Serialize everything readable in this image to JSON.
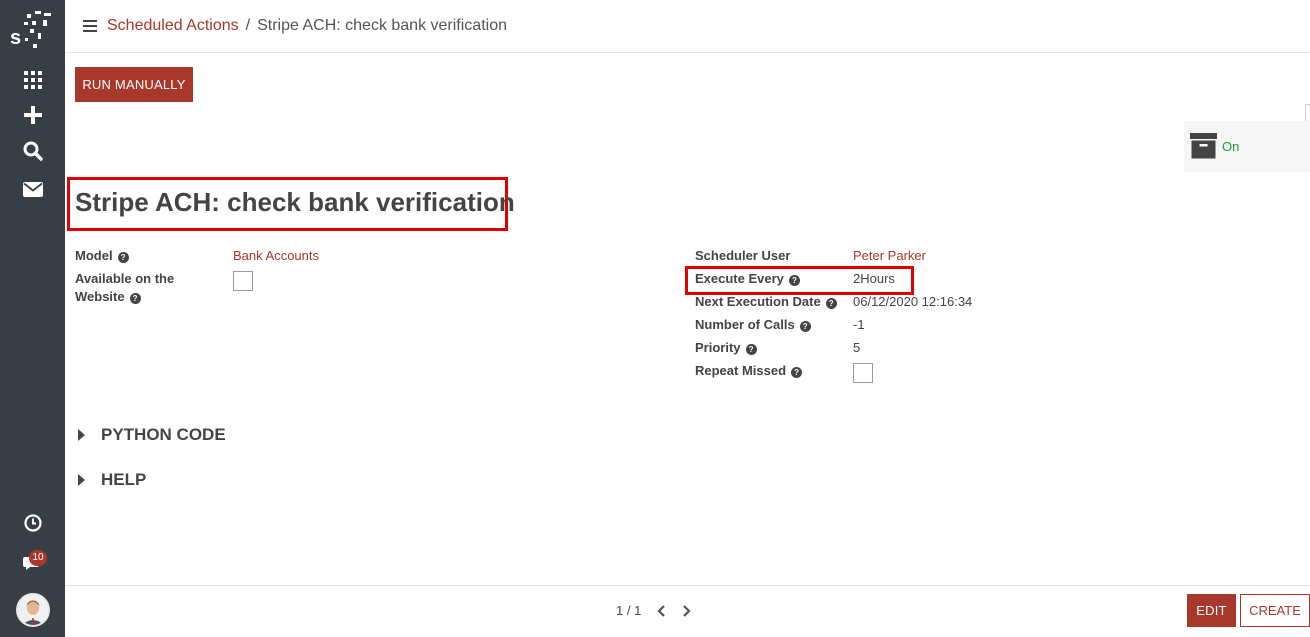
{
  "sidebar": {
    "logo_icon": "odoo-logo-icon",
    "items": [
      {
        "name": "apps-grid-icon"
      },
      {
        "name": "plus-icon"
      },
      {
        "name": "search-icon"
      },
      {
        "name": "envelope-icon"
      }
    ],
    "bottom_items": [
      {
        "name": "clock-icon"
      },
      {
        "name": "chat-icon"
      }
    ],
    "chat_badge": "10"
  },
  "breadcrumb": {
    "parent": "Scheduled Actions",
    "separator": "/",
    "current": "Stripe ACH: check bank verification"
  },
  "toolbar": {
    "run_manually": "RUN MANUALLY"
  },
  "status": {
    "active_label": "On",
    "active_color": "#1b9e37"
  },
  "record": {
    "title": "Stripe ACH: check bank verification",
    "left_fields": {
      "model_label": "Model",
      "model_value": "Bank Accounts",
      "website_label_1": "Available on the",
      "website_label_2": "Website"
    },
    "right_fields": {
      "scheduler_user_label": "Scheduler User",
      "scheduler_user_value": "Peter Parker",
      "execute_every_label": "Execute Every",
      "execute_every_value": "2Hours",
      "next_exec_label": "Next Execution Date",
      "next_exec_value": "06/12/2020 12:16:34",
      "num_calls_label": "Number of Calls",
      "num_calls_value": "-1",
      "priority_label": "Priority",
      "priority_value": "5",
      "repeat_missed_label": "Repeat Missed"
    },
    "help_glyph": "?"
  },
  "sections": {
    "python_code": "PYTHON CODE",
    "help": "HELP"
  },
  "footer": {
    "pager": "1 / 1",
    "edit": "EDIT",
    "create": "CREATE"
  },
  "colors": {
    "brand": "#a8382b",
    "sidebar": "#383e45",
    "highlight": "#e00000"
  }
}
